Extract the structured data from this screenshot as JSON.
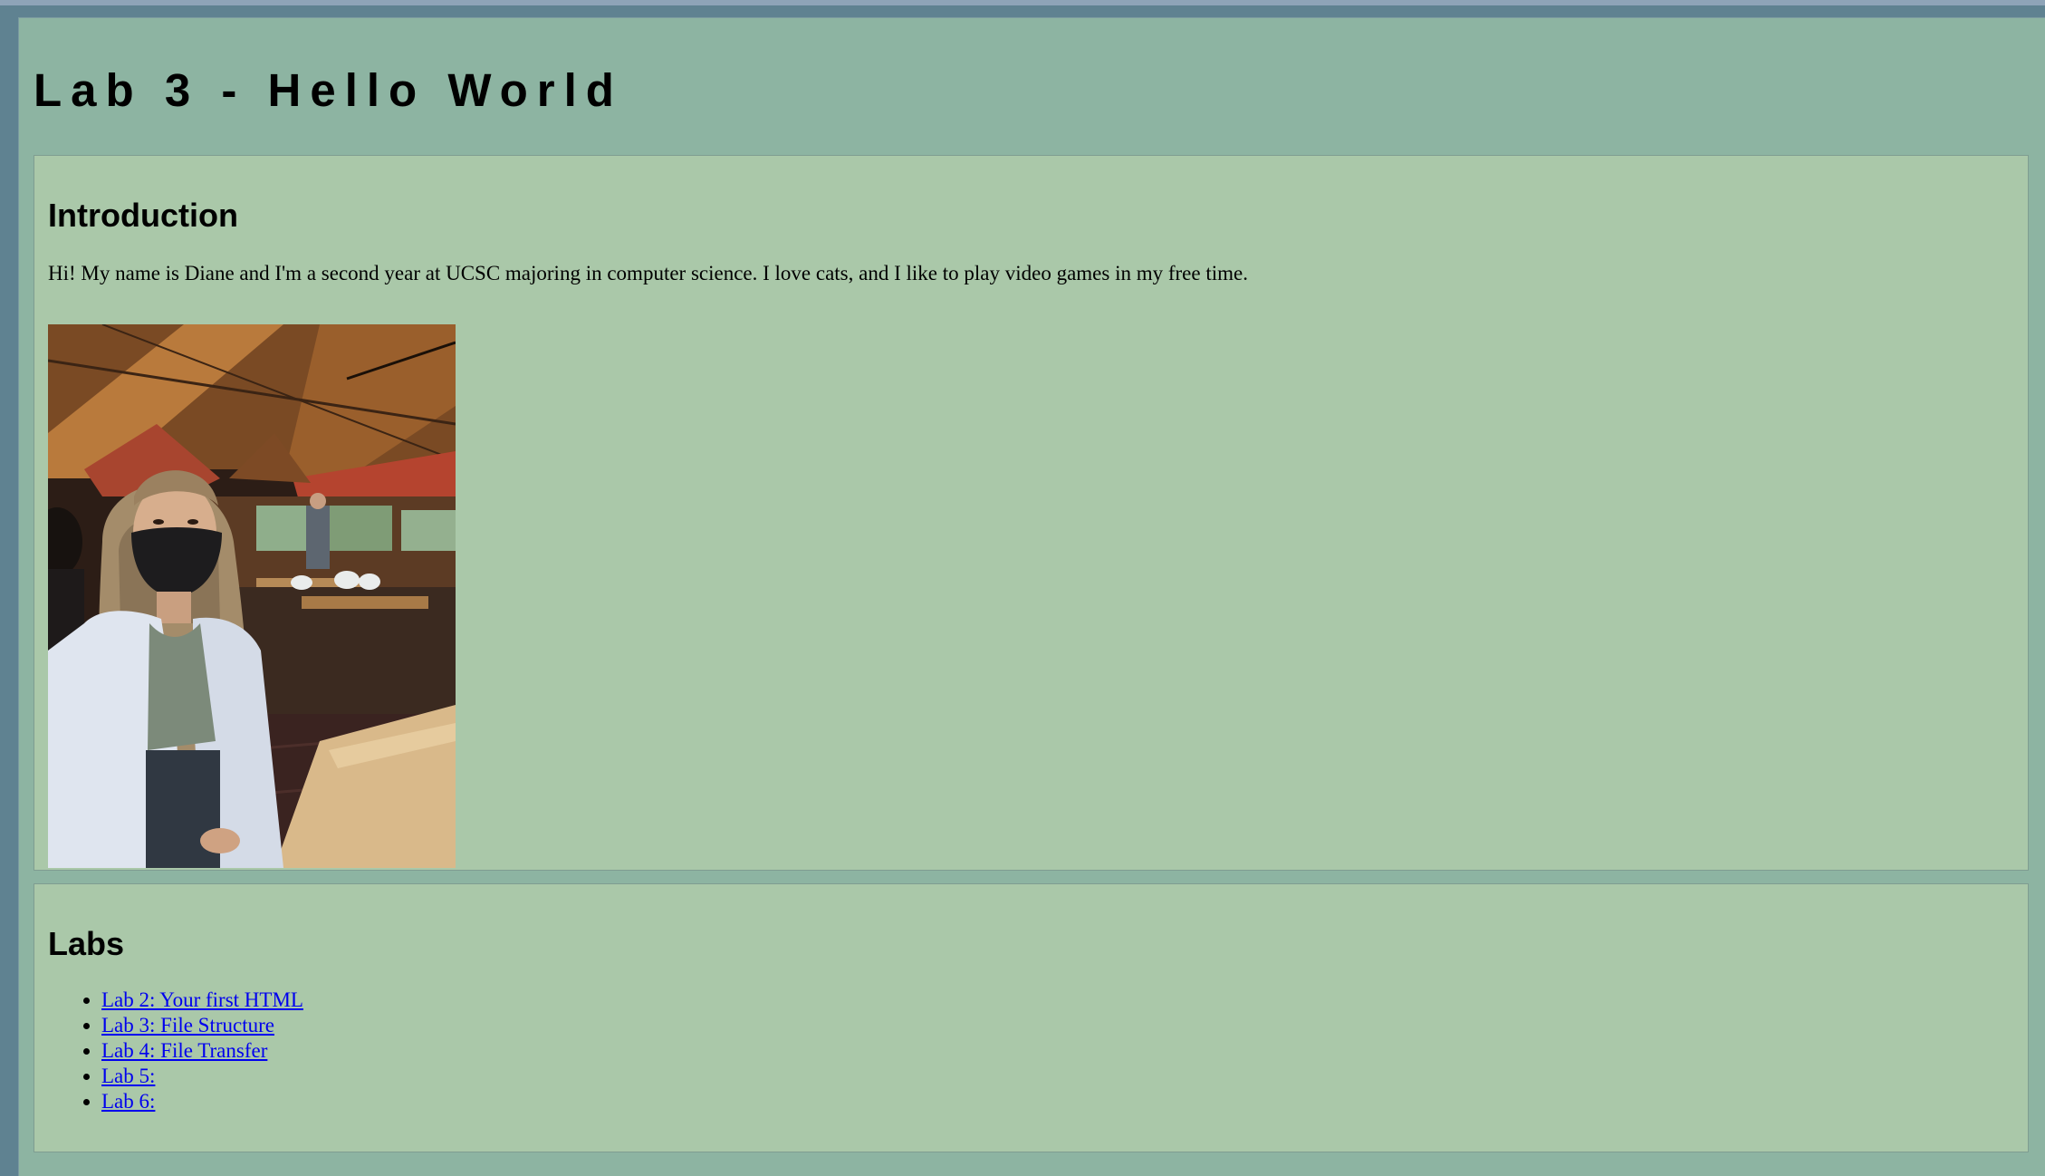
{
  "header": {
    "title": "Lab 3 - Hello World"
  },
  "intro": {
    "heading": "Introduction",
    "text": "Hi! My name is Diane and I'm a second year at UCSC majoring in computer science. I love cats, and I like to play video games in my free time."
  },
  "labs": {
    "heading": "Labs",
    "items": [
      {
        "label": "Lab 2: Your first HTML"
      },
      {
        "label": "Lab 3: File Structure"
      },
      {
        "label": "Lab 4: File Transfer"
      },
      {
        "label": "Lab 5:"
      },
      {
        "label": "Lab 6:"
      }
    ]
  },
  "colors": {
    "window_frame": "#5f8291",
    "page_background": "#8db4a2",
    "card_background": "#aac8a9",
    "link": "#0000ee"
  }
}
